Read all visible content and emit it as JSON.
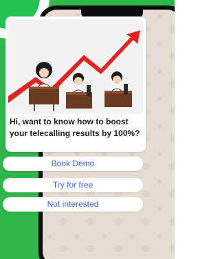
{
  "colors": {
    "background": "#2fb54a",
    "reply_text": "#3d63e3",
    "trend_arrow": "#e3231f",
    "message_text": "#1b1b1b"
  },
  "message": {
    "text": "Hi, want to know how to boost your telecalling results by 100%?"
  },
  "replies": [
    {
      "label": "Book Demo"
    },
    {
      "label": "Try for free"
    },
    {
      "label": "Not interested"
    }
  ],
  "icons": {
    "brand_badge": "whatsapp-logo-icon"
  }
}
